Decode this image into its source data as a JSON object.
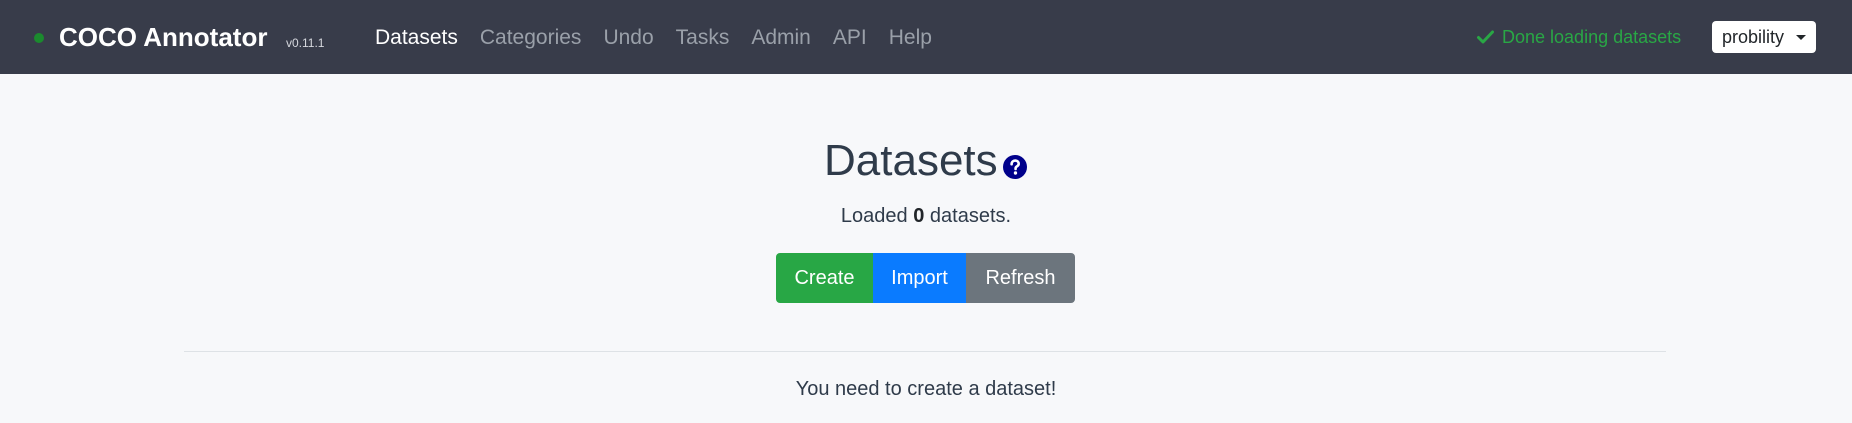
{
  "app": {
    "name": "COCO Annotator",
    "version": "v0.11.1"
  },
  "nav": {
    "items": [
      {
        "label": "Datasets",
        "active": true
      },
      {
        "label": "Categories",
        "active": false
      },
      {
        "label": "Undo",
        "active": false
      },
      {
        "label": "Tasks",
        "active": false
      },
      {
        "label": "Admin",
        "active": false
      },
      {
        "label": "API",
        "active": false
      },
      {
        "label": "Help",
        "active": false
      }
    ]
  },
  "status": {
    "text": "Done loading datasets",
    "icon": "check-icon",
    "color": "#29a745"
  },
  "user": {
    "name": "probility"
  },
  "main": {
    "title": "Datasets",
    "subtitle_prefix": "Loaded ",
    "count": "0",
    "subtitle_suffix": " datasets.",
    "buttons": {
      "create": "Create",
      "import": "Import",
      "refresh": "Refresh"
    },
    "empty_message": "You need to create a dataset!"
  },
  "colors": {
    "navbar": "#383c4a",
    "create": "#28a745",
    "import": "#0a7bff",
    "refresh": "#6c757d",
    "help_icon": "#00008b"
  }
}
